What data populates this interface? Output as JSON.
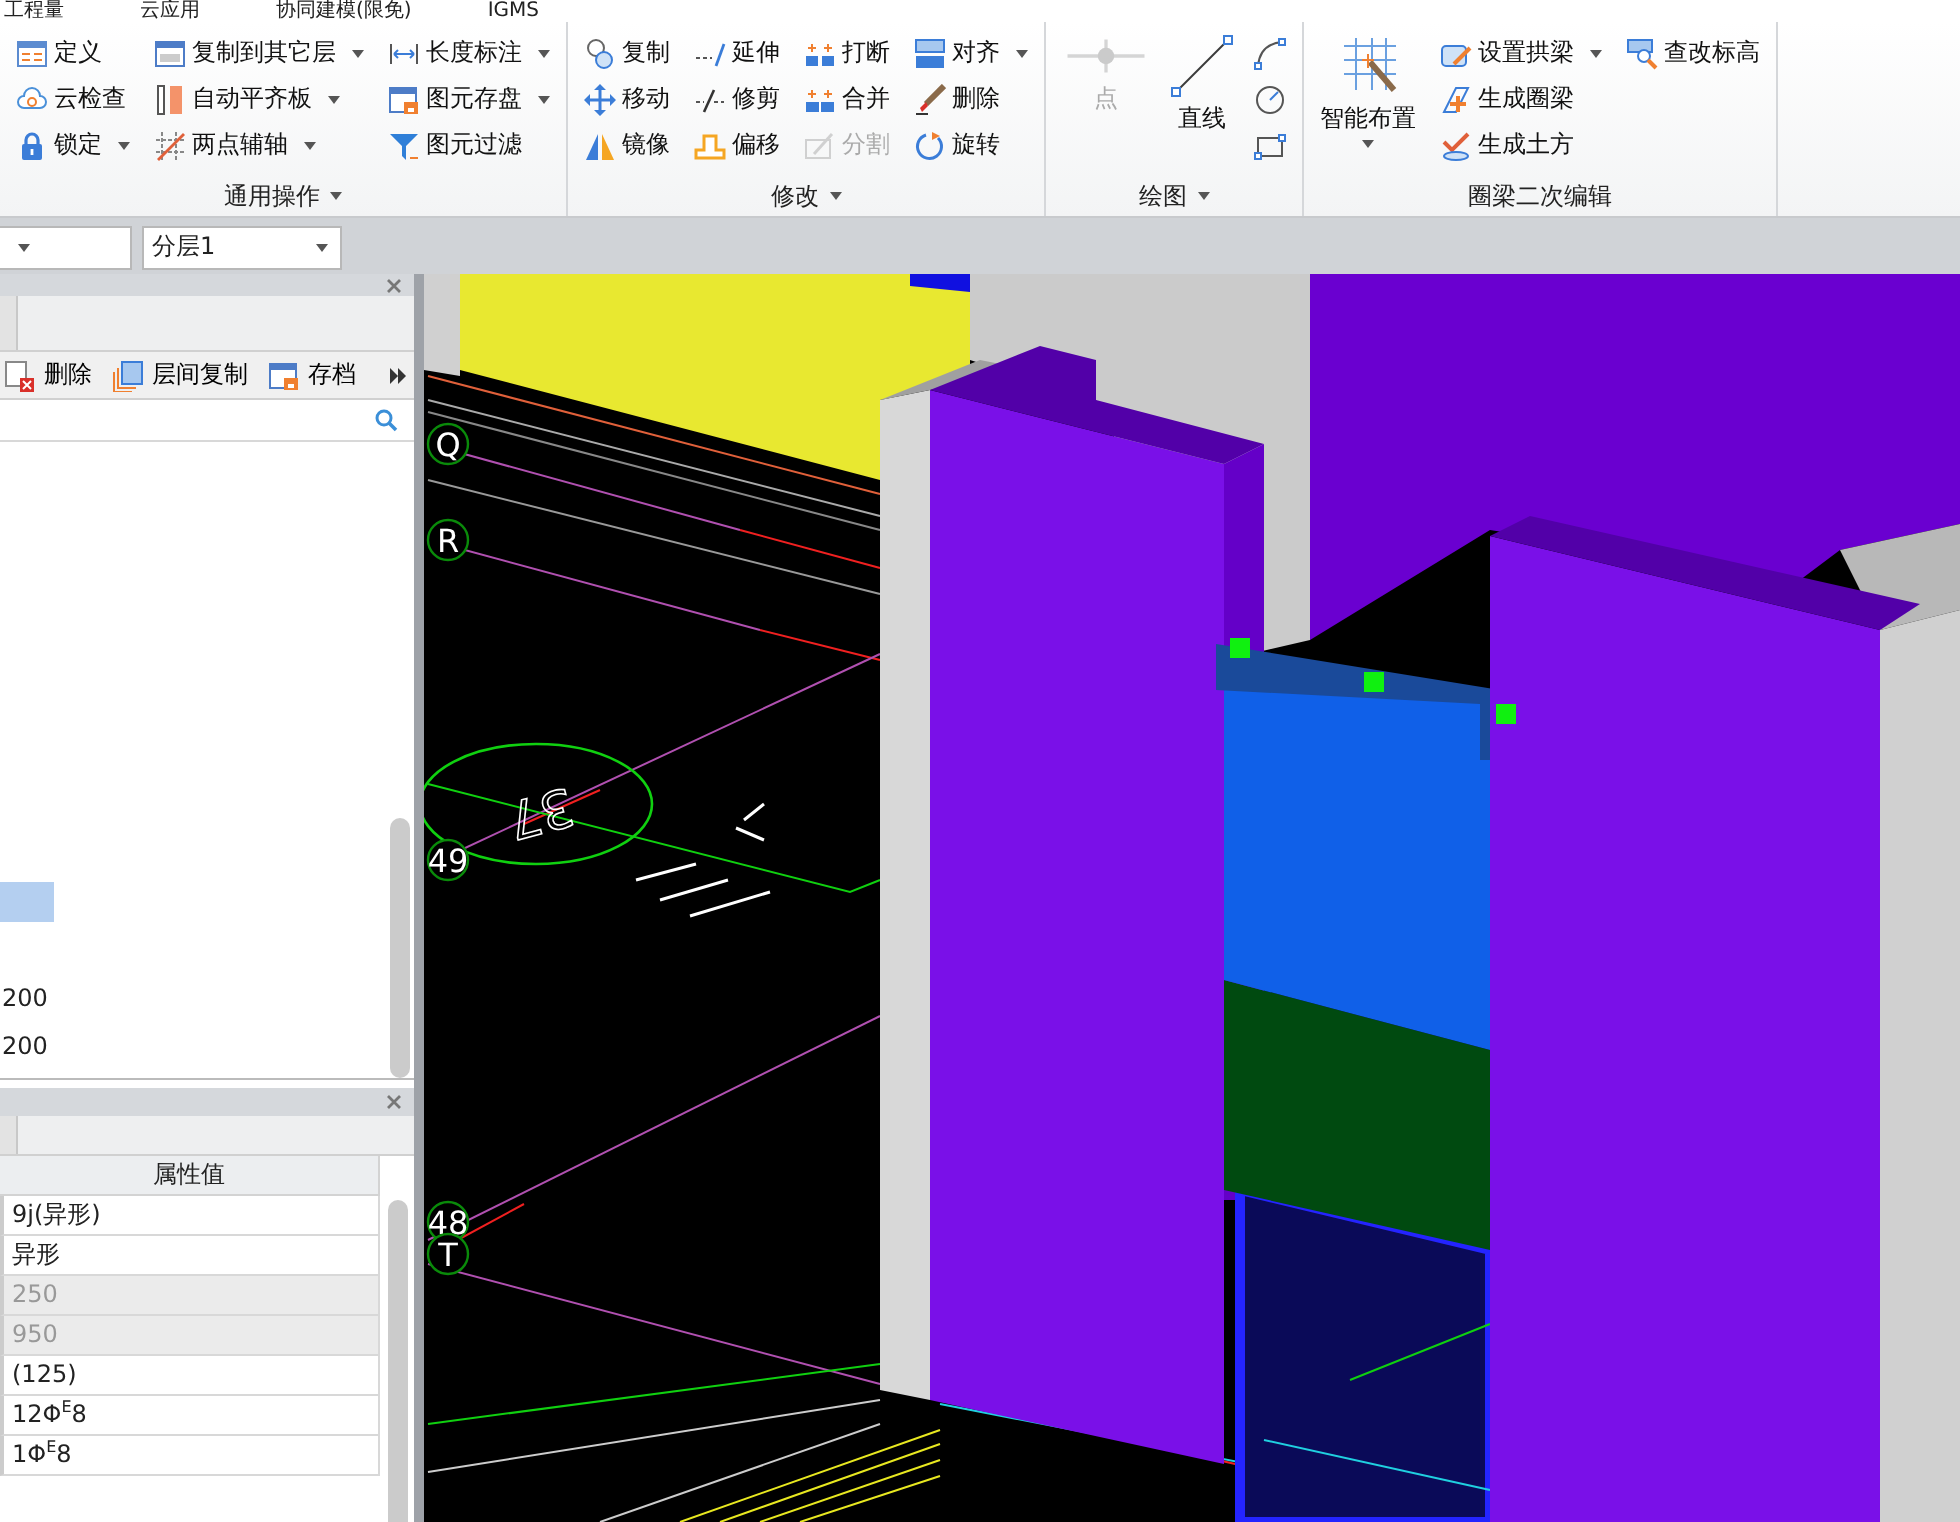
{
  "menu": [
    {
      "label": "工程量"
    },
    {
      "label": "云应用"
    },
    {
      "label": "协同建模(限免)"
    },
    {
      "label": "IGMS"
    }
  ],
  "ribbon": {
    "groups": [
      {
        "title": "通用操作",
        "dropdown": true,
        "items": [
          {
            "kind": "small",
            "label": "定义",
            "dropdown": false,
            "disabled": false
          },
          {
            "kind": "small",
            "label": "云检查",
            "dropdown": false,
            "disabled": false
          },
          {
            "kind": "small",
            "label": "锁定",
            "dropdown": true,
            "disabled": false
          },
          {
            "kind": "small",
            "label": "复制到其它层",
            "dropdown": true,
            "disabled": false
          },
          {
            "kind": "small",
            "label": "自动平齐板",
            "dropdown": true,
            "disabled": false
          },
          {
            "kind": "small",
            "label": "两点辅轴",
            "dropdown": true,
            "disabled": false
          },
          {
            "kind": "small",
            "label": "长度标注",
            "dropdown": true,
            "disabled": false
          },
          {
            "kind": "small",
            "label": "图元存盘",
            "dropdown": true,
            "disabled": false
          },
          {
            "kind": "small",
            "label": "图元过滤",
            "dropdown": false,
            "disabled": false
          }
        ]
      },
      {
        "title": "修改",
        "dropdown": true,
        "items": [
          {
            "kind": "small",
            "label": "复制",
            "dropdown": false,
            "disabled": false
          },
          {
            "kind": "small",
            "label": "移动",
            "dropdown": false,
            "disabled": false
          },
          {
            "kind": "small",
            "label": "镜像",
            "dropdown": false,
            "disabled": false
          },
          {
            "kind": "small",
            "label": "延伸",
            "dropdown": false,
            "disabled": false
          },
          {
            "kind": "small",
            "label": "修剪",
            "dropdown": false,
            "disabled": false
          },
          {
            "kind": "small",
            "label": "偏移",
            "dropdown": false,
            "disabled": false
          },
          {
            "kind": "small",
            "label": "打断",
            "dropdown": false,
            "disabled": false
          },
          {
            "kind": "small",
            "label": "合并",
            "dropdown": false,
            "disabled": false
          },
          {
            "kind": "small",
            "label": "分割",
            "dropdown": false,
            "disabled": true
          },
          {
            "kind": "small",
            "label": "对齐",
            "dropdown": true,
            "disabled": false
          },
          {
            "kind": "small",
            "label": "删除",
            "dropdown": false,
            "disabled": false
          },
          {
            "kind": "small",
            "label": "旋转",
            "dropdown": false,
            "disabled": false
          }
        ]
      },
      {
        "title": "绘图",
        "dropdown": true,
        "items": [
          {
            "kind": "large",
            "label": "点",
            "dropdown": false,
            "disabled": true
          },
          {
            "kind": "large",
            "label": "直线",
            "dropdown": false,
            "disabled": false
          },
          {
            "kind": "icon",
            "disabled": false
          },
          {
            "kind": "icon",
            "disabled": false
          },
          {
            "kind": "icon",
            "disabled": false
          }
        ]
      },
      {
        "title": "圈梁二次编辑",
        "dropdown": false,
        "items": [
          {
            "kind": "large",
            "label": "智能布置",
            "dropdown": true,
            "disabled": false
          },
          {
            "kind": "small",
            "label": "设置拱梁",
            "dropdown": true,
            "disabled": false
          },
          {
            "kind": "small",
            "label": "生成圈梁",
            "dropdown": false,
            "disabled": false
          },
          {
            "kind": "small",
            "label": "生成土方",
            "dropdown": false,
            "disabled": false
          },
          {
            "kind": "small",
            "label": "查改标高",
            "dropdown": false,
            "disabled": false
          }
        ]
      }
    ]
  },
  "layer_select": {
    "value": "分层1"
  },
  "component_panel": {
    "toolbar": [
      {
        "label": "删除"
      },
      {
        "label": "层间复制"
      },
      {
        "label": "存档"
      }
    ],
    "rows": [
      {
        "selected": true
      },
      {
        "text": "200",
        "selected": false
      },
      {
        "text": "200",
        "selected": false
      }
    ]
  },
  "property_panel": {
    "column": "属性值",
    "rows": [
      {
        "value": "9j(异形)",
        "disabled": false
      },
      {
        "value": "异形",
        "disabled": false
      },
      {
        "value": "250",
        "disabled": true
      },
      {
        "value": "950",
        "disabled": true
      },
      {
        "value": "(125)",
        "disabled": false
      },
      {
        "value": "12Φ$^{E}$8",
        "disabled": false
      },
      {
        "value": "1Φ$^{E}$8",
        "disabled": false
      }
    ]
  },
  "canvas": {
    "axis_labels": [
      "Q",
      "R",
      "49",
      "48",
      "T"
    ],
    "annotation": "37"
  }
}
